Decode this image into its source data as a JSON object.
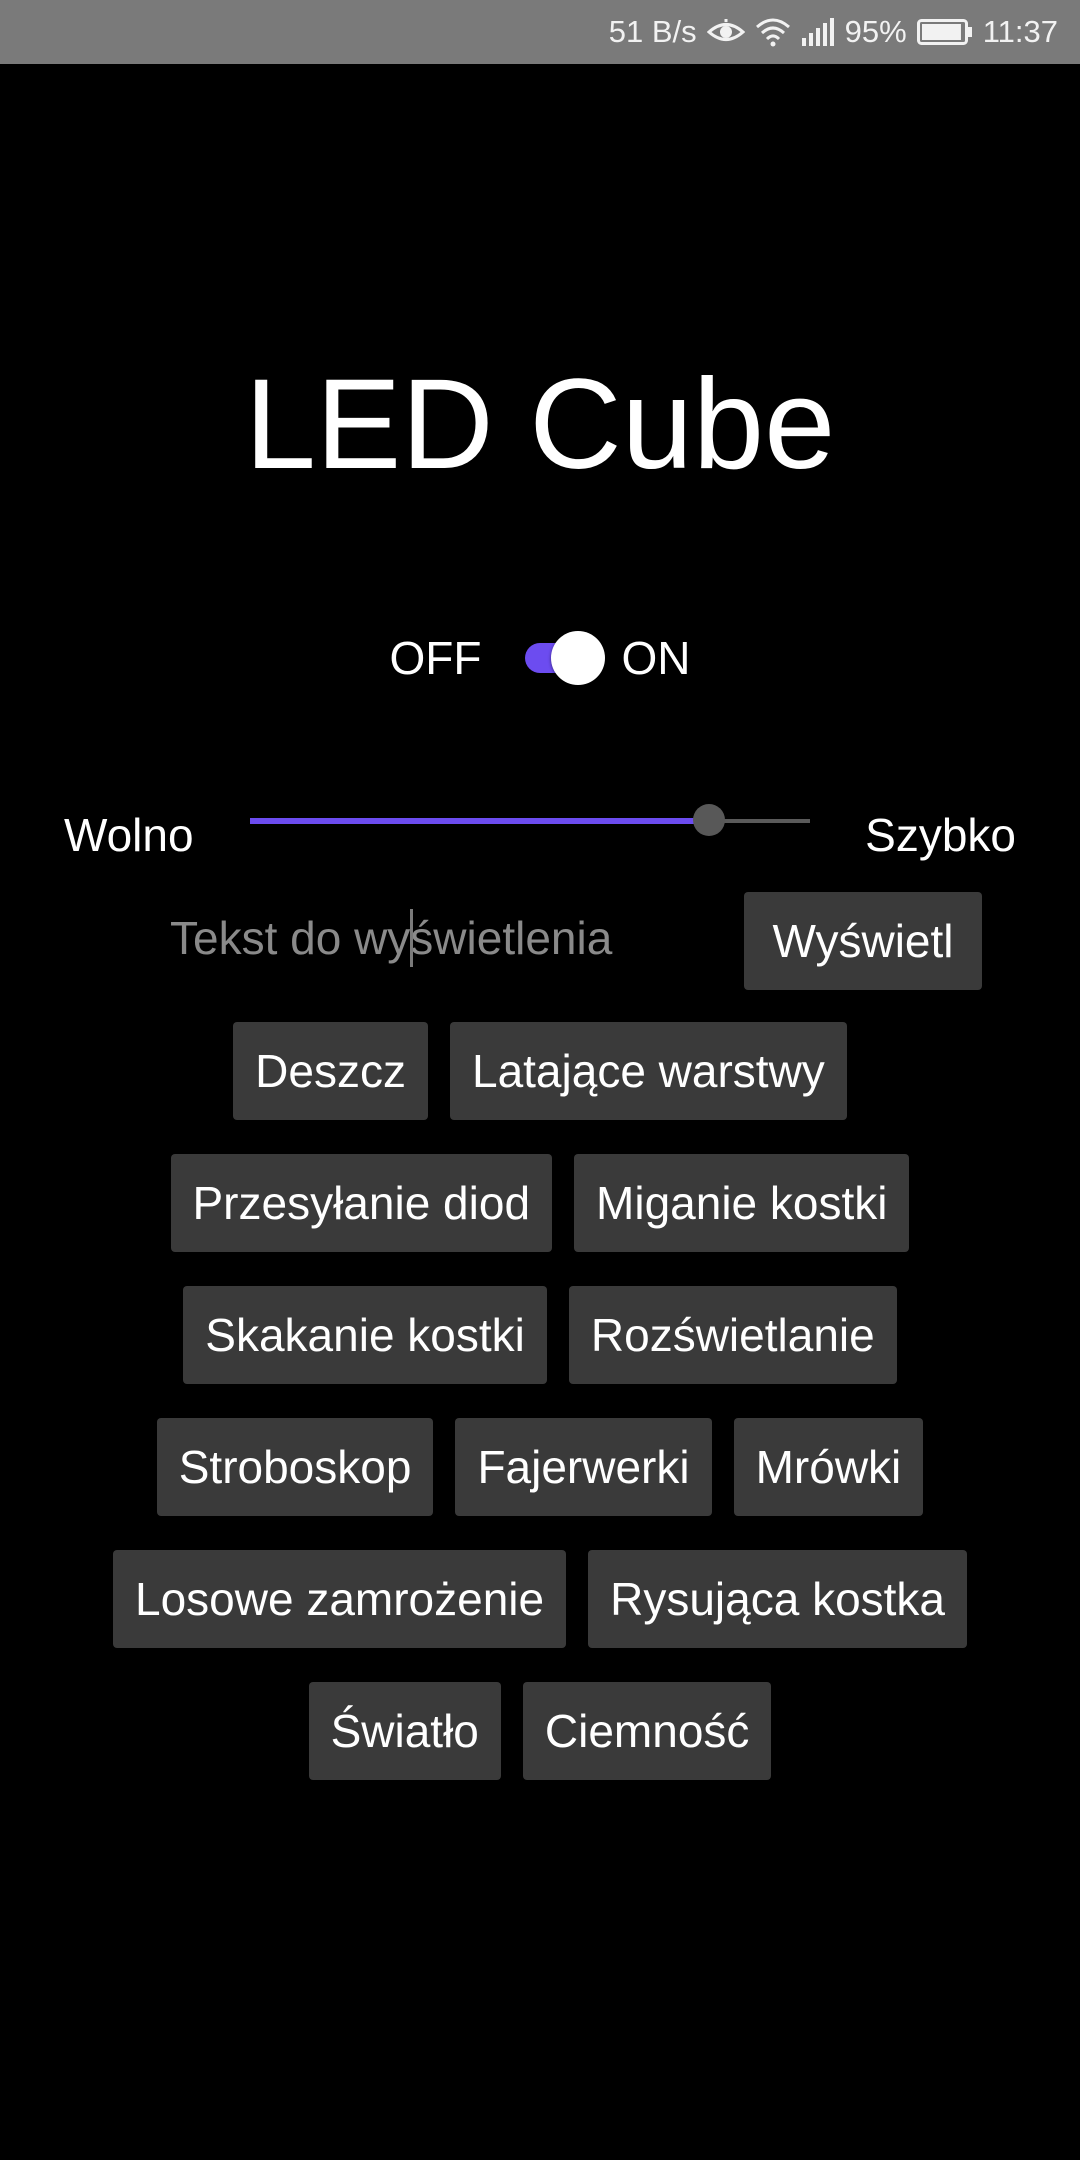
{
  "status_bar": {
    "net_speed": "51 B/s",
    "battery_percent": "95%",
    "time": "11:37",
    "icons": [
      "eye-icon",
      "wifi-icon",
      "signal-icon",
      "battery-icon"
    ],
    "battery_level": 0.95,
    "background": "#7a7a7a"
  },
  "title": "LED Cube",
  "power_switch": {
    "off_label": "OFF",
    "on_label": "ON",
    "state": "on",
    "accent": "#6c4cf0"
  },
  "speed_slider": {
    "left_label": "Wolno",
    "right_label": "Szybko",
    "value": 0.82,
    "accent": "#6c4cf0"
  },
  "text_input": {
    "value": "",
    "placeholder": "Tekst do wyświetlenia"
  },
  "display_button": {
    "label": "Wyświetl"
  },
  "effect_rows": [
    [
      "Deszcz",
      "Latające warstwy"
    ],
    [
      "Przesyłanie diod",
      "Miganie kostki"
    ],
    [
      "Skakanie kostki",
      "Rozświetlanie"
    ],
    [
      "Stroboskop",
      "Fajerwerki",
      "Mrówki"
    ],
    [
      "Losowe zamrożenie",
      "Rysująca kostka"
    ],
    [
      "Światło",
      "Ciemność"
    ]
  ]
}
